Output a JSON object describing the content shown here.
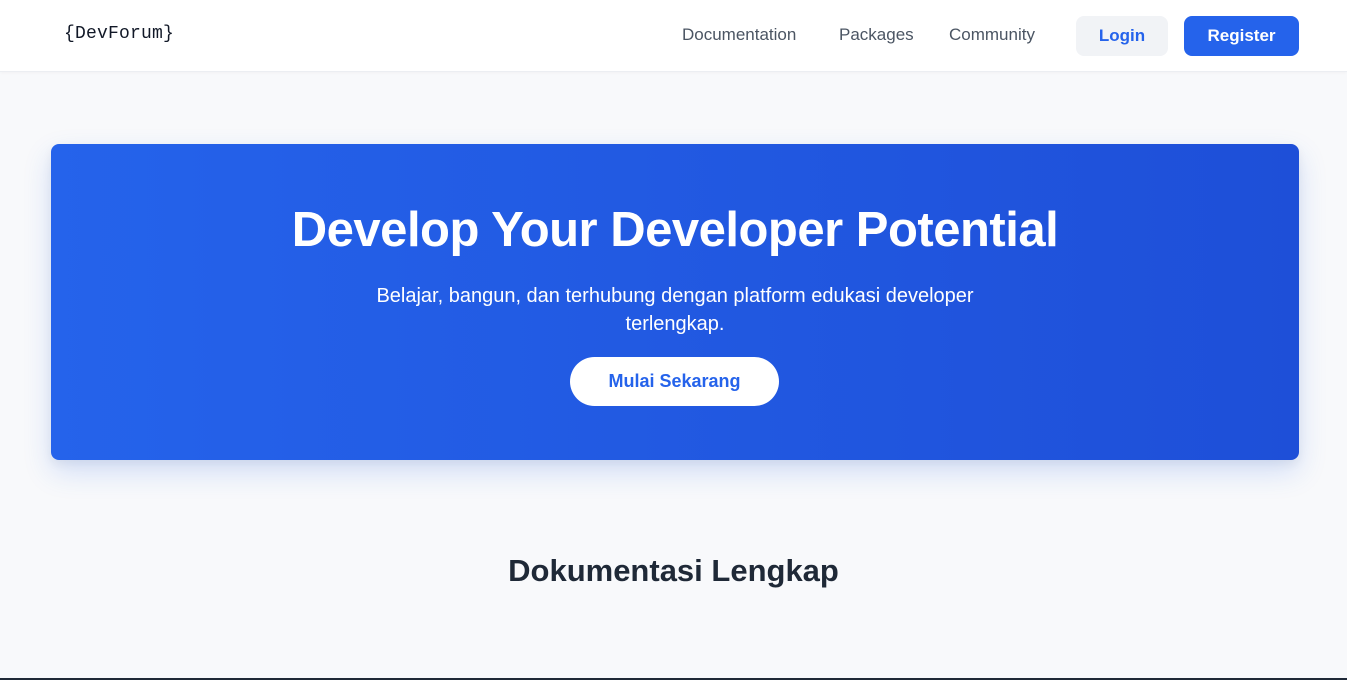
{
  "navbar": {
    "logo": "{DevForum}",
    "links": [
      "Documentation",
      "Packages",
      "Community"
    ],
    "login_label": "Login",
    "register_label": "Register"
  },
  "hero": {
    "title": "Develop Your Developer Potential",
    "subtitle": "Belajar, bangun, dan terhubung dengan platform edukasi developer terlengkap.",
    "cta_label": "Mulai Sekarang"
  },
  "section": {
    "title": "Dokumentasi Lengkap"
  },
  "colors": {
    "accent": "#2563eb",
    "hero_gradient_end": "#1e4fd8",
    "page_background": "#f8f9fb",
    "heading_text": "#1f2937"
  }
}
